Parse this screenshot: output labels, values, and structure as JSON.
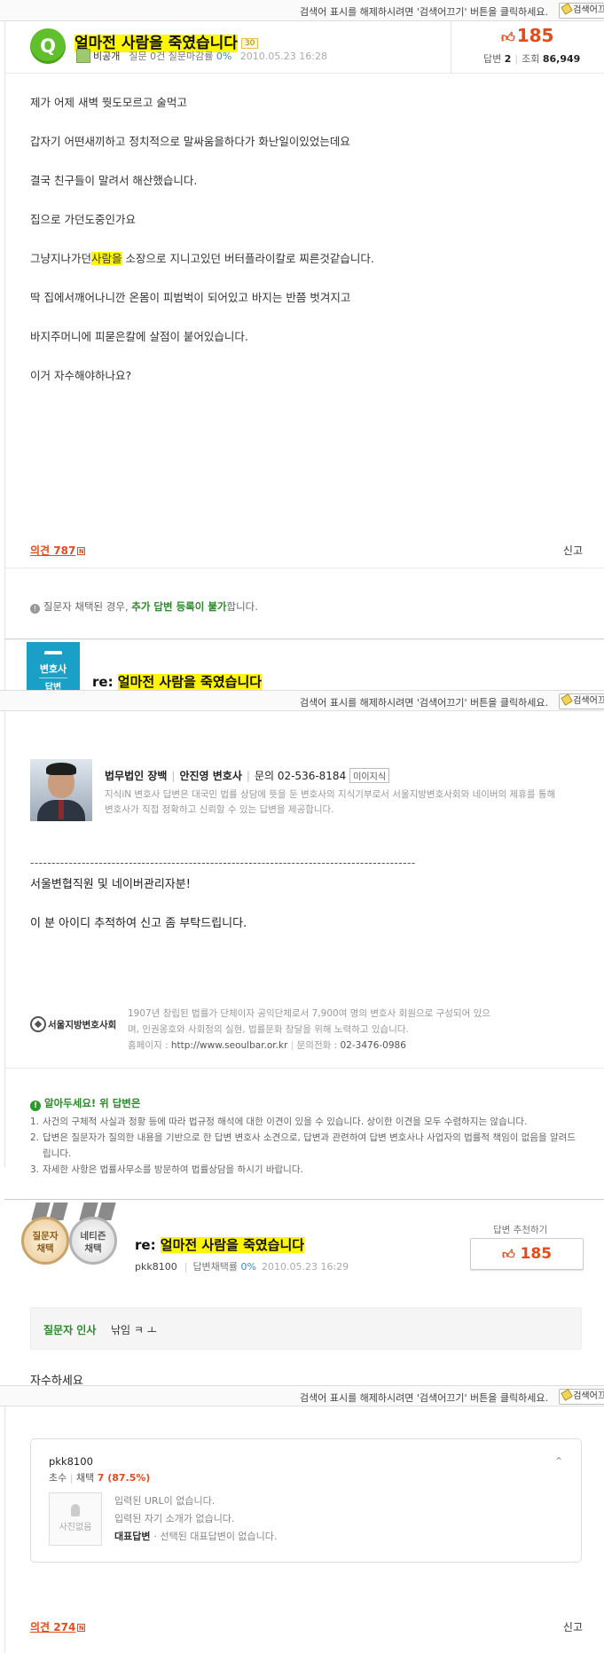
{
  "search_bar": {
    "notice": "검색어 표시를 해제하시려면 '검색어끄기' 버튼을 클릭하세요.",
    "button_label": "검색어끄"
  },
  "question": {
    "badge": "Q",
    "title_highlight": "얼마전 사람을 죽였습니다",
    "rank_tag": "30",
    "author": "비공개",
    "meta_prefix": "질문 0건 질문마감률",
    "close_rate": "0%",
    "date": "2010.05.23 16:28",
    "likes": "185",
    "answers_label": "답변",
    "answers_count": "2",
    "views_label": "조회",
    "views_count": "86,949",
    "body": [
      "제가 어제 새벽 뭣도모르고 술먹고",
      "갑자기 어떤새끼하고 정치적으로 말싸움을하다가 화난일이있었는데요",
      "결국 친구들이 말려서 해산했습니다.",
      "집으로 가던도중인가요",
      {
        "pre": "그냥지나가던",
        "hl": "사람을",
        "post": " 소장으로 지니고있던 버터플라이칼로 찌른것같습니다."
      },
      "딱 집에서깨어나니깐 온몸이 피범벅이 되어있고 바지는 반쯤 벗겨지고",
      "바지주머니에 피묻은칼에 살점이 붙어있습니다.",
      "이거 자수해야하나요?"
    ],
    "opinion_label": "의견",
    "opinion_count": "787",
    "opinion_new": "N",
    "report": "신고"
  },
  "adopt_notice": {
    "prefix": "질문자 채택된 경우, ",
    "green": "추가 답변 등록이 불가",
    "suffix": "합니다."
  },
  "answer1": {
    "badge_line1": "변호사",
    "badge_line2": "답변",
    "re": "re: ",
    "title_highlight": "얼마전 사람을 죽였습니다",
    "firm": "법무법인 장백",
    "lawyer": "안진영 변호사",
    "contact": "문의 02-536-8184",
    "tag": "미이지식",
    "desc": "지식iN 변호사 답변은 대국민 법률 상담에 뜻을 둔 변호사의 지식기부로서 서울지방변호사회와 네이버의 제휴를 통해 변호사가 직접 정확하고 신뢰할 수 있는 답변을 제공합니다.",
    "dashes": "------------------------------------------------------------------------------------------",
    "line1": "서울변협직원 및 네이버관리자분!",
    "line2": "이 분 아이디 추적하여 신고 좀 부탁드립니다.",
    "seoul_name": "서울지방변호사회",
    "seoul_desc": "1907년 창립된 법률가 단체이자 공익단체로서 7,900여 명의 변호사 회원으로 구성되어 있으며, 인권옹호와 사회정의 실현, 법률문화 창달을 위해 노력하고 있습니다.",
    "seoul_home_label": "홈페이지 : ",
    "seoul_home": "http://www.seoulbar.or.kr",
    "seoul_tel_label": "문의전화 : ",
    "seoul_tel": "02-3476-0986",
    "caution_title": "알아두세요! 위 답변은",
    "cautions": [
      "사건의 구체적 사실과 정황 등에 따라 법규정 해석에 대한 이견이 있을 수 있습니다. 상이한 이견을 모두 수렴하지는 않습니다.",
      "답변은 질문자가 질의한 내용을 기반으로 한 답변 변호사 소견으로, 답변과 관련하여 답변 변호사나 사업자의 법률적 책임이 없음을 알려드립니다.",
      "자세한 사항은 법률사무소를 방문하여 법률상담을 하시기 바랍니다."
    ]
  },
  "answer2": {
    "medal1_l1": "질문자",
    "medal1_l2": "채택",
    "medal2_l1": "네티즌",
    "medal2_l2": "채택",
    "re": "re: ",
    "title_highlight": "얼마전 사람을 죽였습니다",
    "author": "pkk8100",
    "meta_prefix": "답변채택률",
    "adopt_rate": "0%",
    "date": "2010.05.23 16:29",
    "recommend_label": "답변 추천하기",
    "likes": "185",
    "greeting_label": "질문자 인사",
    "greeting_text": "낚임 ㅋ ㅗ",
    "body": "자수하세요",
    "profile": {
      "id": "pkk8100",
      "rank_label": "초수",
      "adopt_label": "채택",
      "adopt_value": "7 (87.5%)",
      "no_photo": "사진없음",
      "url_text": "입력된 URL이 없습니다.",
      "intro_text": "입력된 자기 소개가 없습니다.",
      "rep_label": "대표답변",
      "rep_text": "· 선택된 대표답변이 없습니다."
    },
    "opinion_label": "의견",
    "opinion_count": "274",
    "opinion_new": "N",
    "report": "신고"
  },
  "colors": {
    "highlight": "#fff700",
    "accent": "#e24c1c",
    "green": "#61be2c",
    "lawyer_badge": "#1aa0c7"
  }
}
